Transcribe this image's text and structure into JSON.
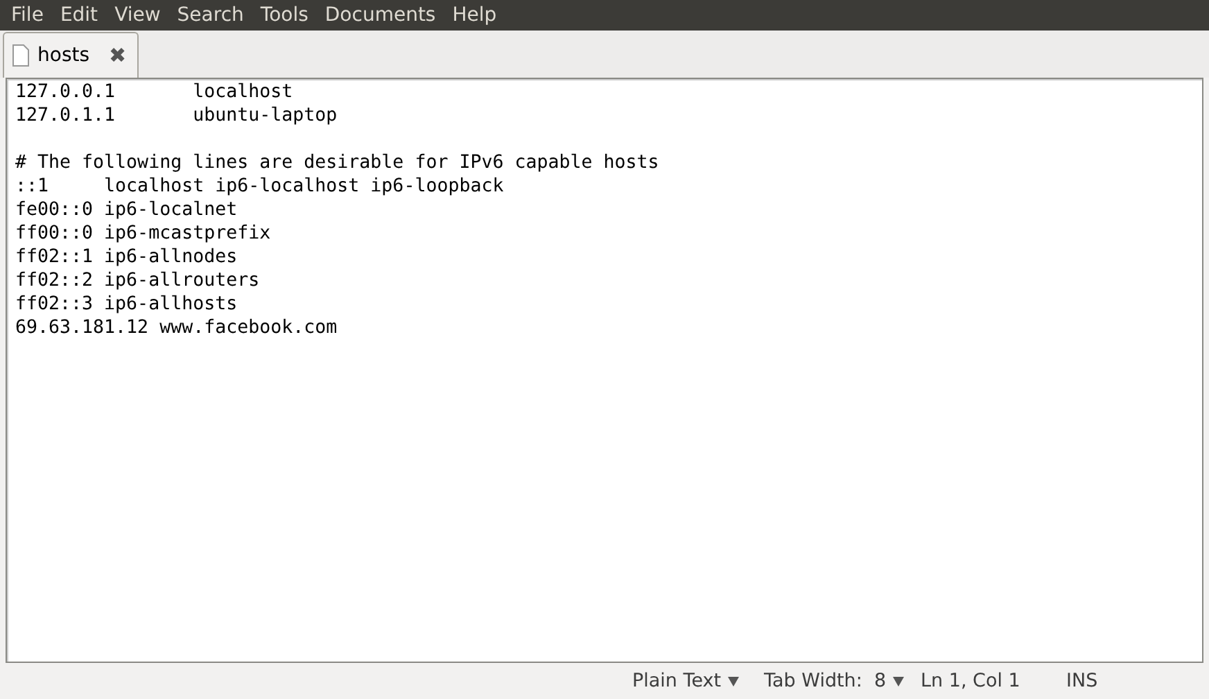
{
  "menu": [
    "File",
    "Edit",
    "View",
    "Search",
    "Tools",
    "Documents",
    "Help"
  ],
  "tabs": [
    {
      "label": "hosts",
      "selected": true,
      "close": "✖"
    }
  ],
  "editor": {
    "blocks": [
      [
        "127.0.0.1\tlocalhost",
        "127.0.1.1\tubuntu-laptop"
      ],
      [
        "# The following lines are desirable for IPv6 capable hosts",
        "::1     localhost ip6-localhost ip6-loopback",
        "fe00::0 ip6-localnet",
        "ff00::0 ip6-mcastprefix",
        "ff02::1 ip6-allnodes",
        "ff02::2 ip6-allrouters",
        "ff02::3 ip6-allhosts",
        "69.63.181.12 www.facebook.com"
      ]
    ]
  },
  "status_bar": {
    "language": "Plain Text",
    "tab_width": "Tab Width:  8",
    "position": "Ln 1, Col 1",
    "mode": "INS"
  }
}
